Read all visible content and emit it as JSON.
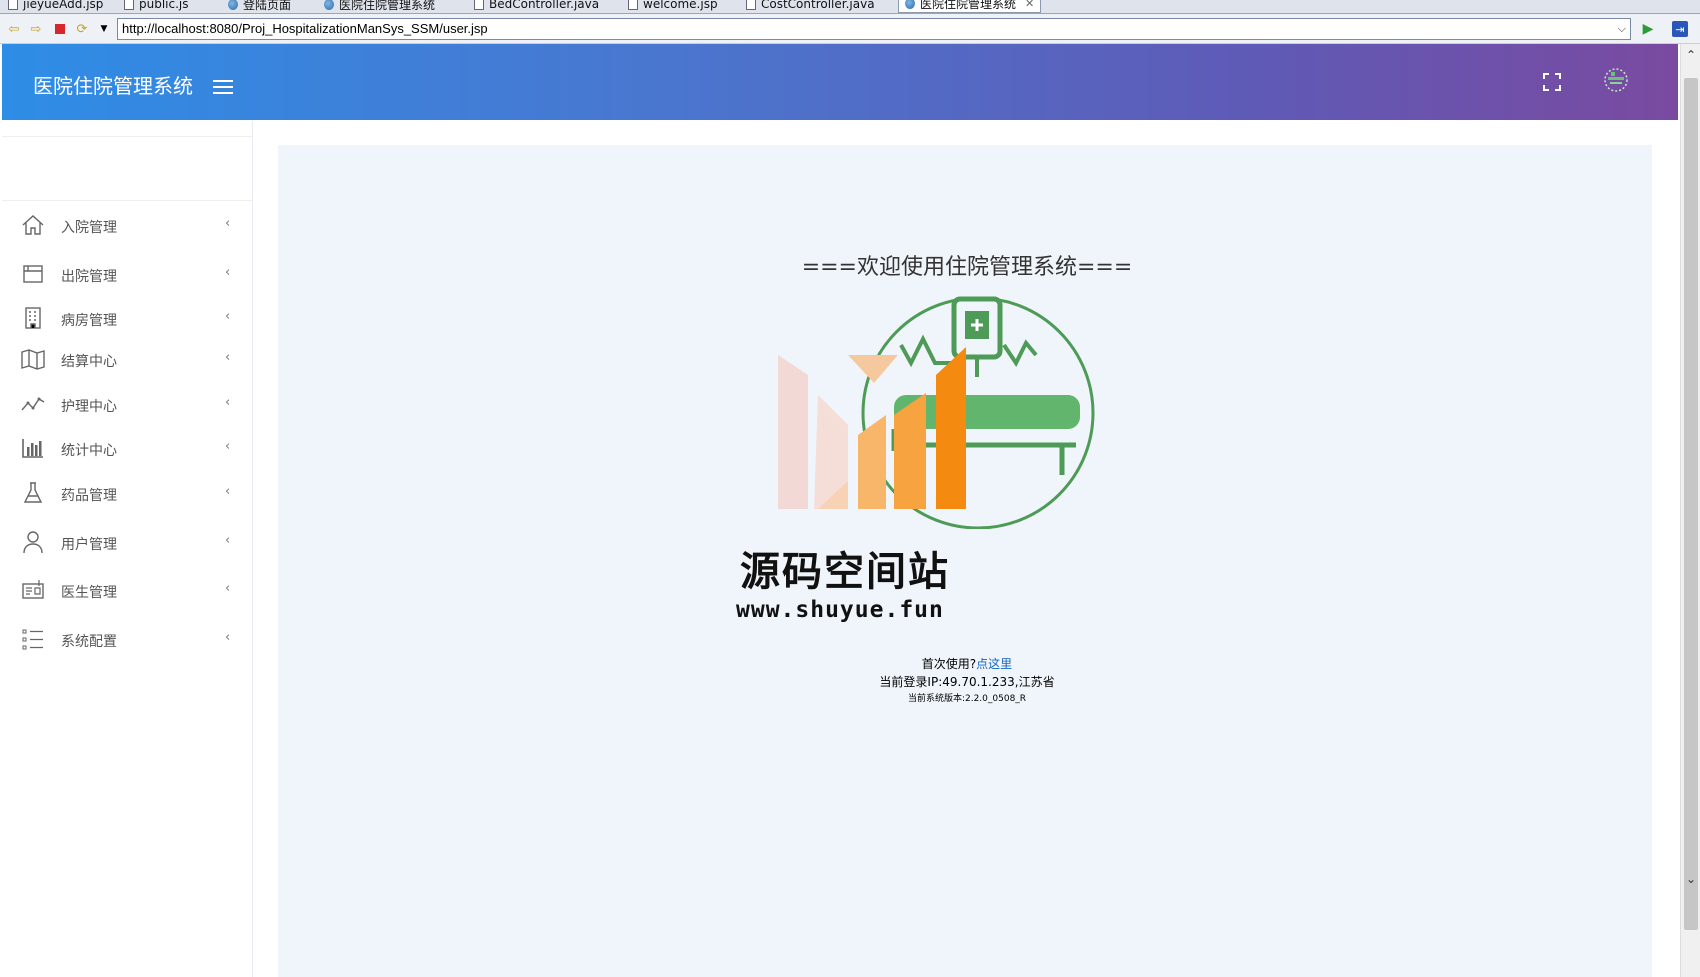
{
  "editor_tabs": [
    {
      "label": "jieyueAdd.jsp",
      "icon": "file-icon"
    },
    {
      "label": "public.js",
      "icon": "file-icon"
    },
    {
      "label": "登陆页面",
      "icon": "globe-icon"
    },
    {
      "label": "医院住院管理系统",
      "icon": "globe-icon"
    },
    {
      "label": "BedController.java",
      "icon": "file-icon"
    },
    {
      "label": "welcome.jsp",
      "icon": "file-icon"
    },
    {
      "label": "CostController.java",
      "icon": "file-icon"
    },
    {
      "label": "医院住院管理系统",
      "icon": "globe-icon",
      "active": true
    }
  ],
  "browser": {
    "url": "http://localhost:8080/Proj_HospitalizationManSys_SSM/user.jsp"
  },
  "header": {
    "brand": "医院住院管理系统",
    "gradient_start": "#2e8de6",
    "gradient_end": "#7a4aa0"
  },
  "sidebar": {
    "items": [
      {
        "label": "入院管理",
        "icon": "home-icon"
      },
      {
        "label": "出院管理",
        "icon": "window-icon"
      },
      {
        "label": "病房管理",
        "icon": "building-icon"
      },
      {
        "label": "结算中心",
        "icon": "map-icon"
      },
      {
        "label": "护理中心",
        "icon": "line-chart-icon"
      },
      {
        "label": "统计中心",
        "icon": "bar-chart-icon"
      },
      {
        "label": "药品管理",
        "icon": "flask-icon"
      },
      {
        "label": "用户管理",
        "icon": "user-icon"
      },
      {
        "label": "医生管理",
        "icon": "id-card-icon"
      },
      {
        "label": "系统配置",
        "icon": "list-icon"
      }
    ]
  },
  "main": {
    "welcome": "===欢迎使用住院管理系统===",
    "site_name": "源码空间站",
    "site_url": "www.shuyue.fun",
    "first_use_text": "首次使用?",
    "first_use_link": "点这里",
    "login_ip": "当前登录IP:49.70.1.233,江苏省",
    "version": "当前系统版本:2.2.0_0508_R"
  }
}
